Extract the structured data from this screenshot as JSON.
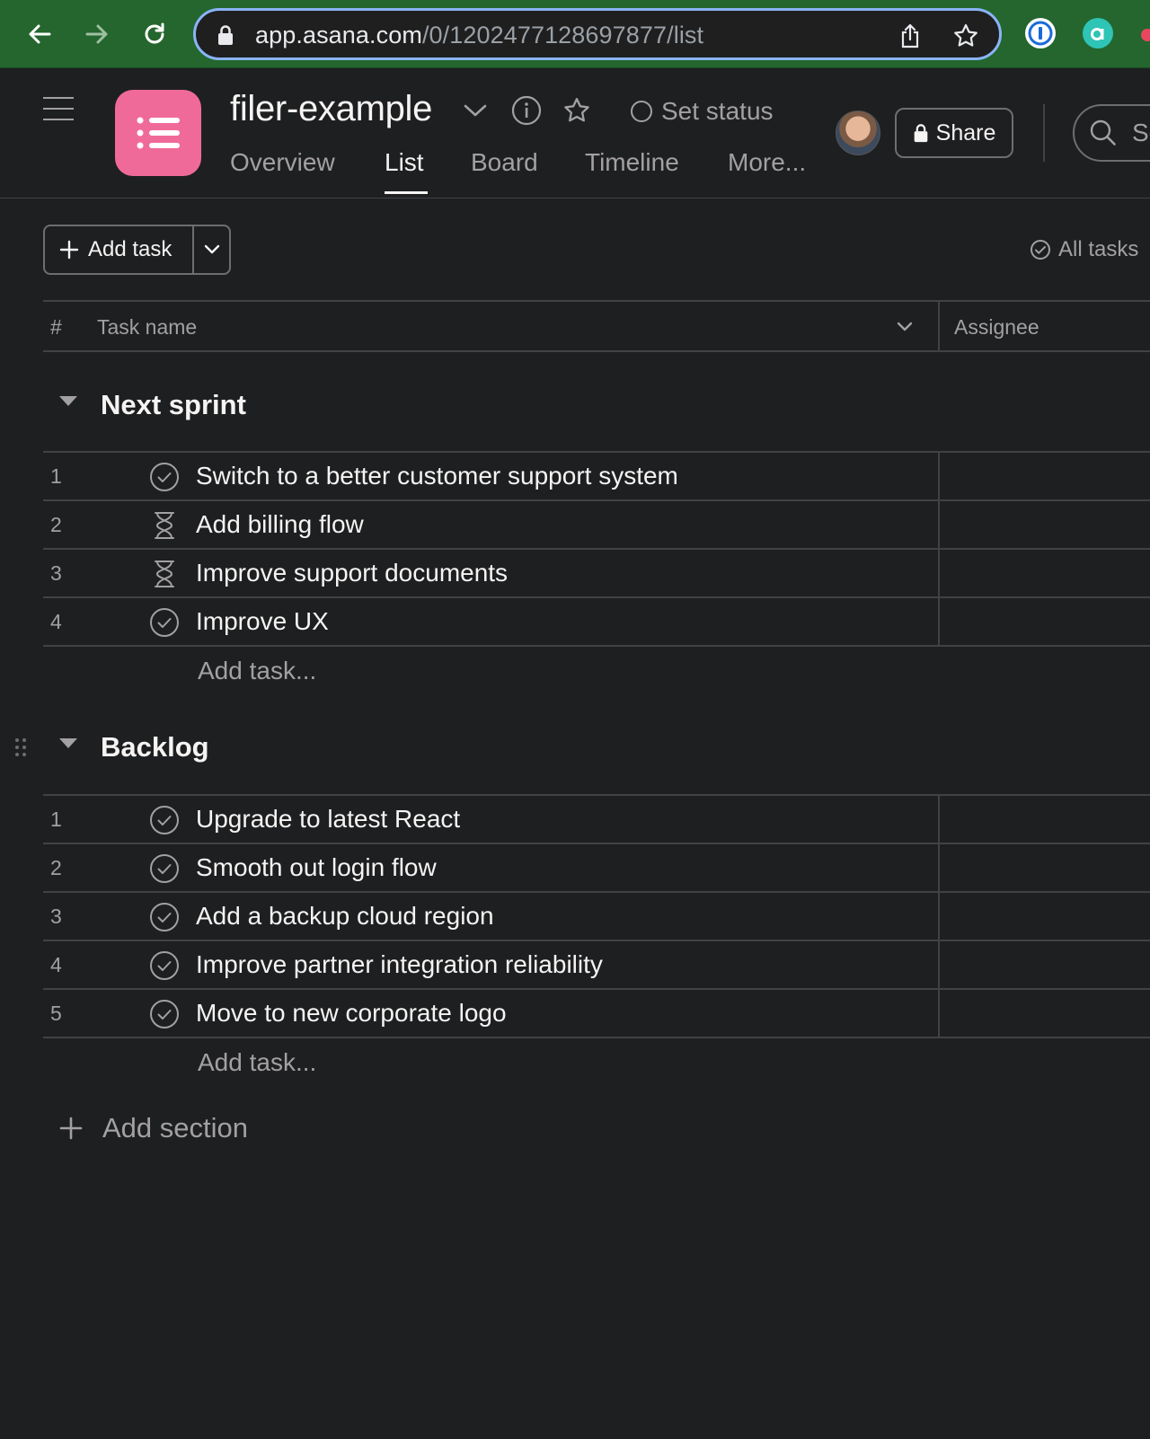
{
  "browser": {
    "url_host": "app.asana.com",
    "url_path": "/0/1202477128697877/list",
    "colors": {
      "toolbar": "#24662e",
      "omnibox_focus": "#8ab4f8"
    },
    "icons": [
      "back-arrow-icon",
      "forward-arrow-icon",
      "reload-icon",
      "lock-icon",
      "share-page-icon",
      "bookmark-star-icon",
      "password-manager-extension-icon",
      "asana-extension-icon"
    ]
  },
  "header": {
    "project_title": "filer-example",
    "set_status_label": "Set status",
    "tabs": [
      {
        "label": "Overview",
        "active": false
      },
      {
        "label": "List",
        "active": true
      },
      {
        "label": "Board",
        "active": false
      },
      {
        "label": "Timeline",
        "active": false
      },
      {
        "label": "More...",
        "active": false
      }
    ],
    "share_label": "Share",
    "search_placeholder": "Se",
    "project_color": "#f06a99"
  },
  "toolbar": {
    "add_task_label": "Add task",
    "filter_label": "All tasks"
  },
  "table": {
    "columns": {
      "number": "#",
      "task_name": "Task name",
      "assignee": "Assignee"
    },
    "add_task_inline": "Add task...",
    "sections": [
      {
        "name": "Next sprint",
        "tasks": [
          {
            "num": "1",
            "status": "check",
            "name": "Switch to a better customer support system"
          },
          {
            "num": "2",
            "status": "hourglass",
            "name": "Add billing flow"
          },
          {
            "num": "3",
            "status": "hourglass",
            "name": "Improve support documents"
          },
          {
            "num": "4",
            "status": "check",
            "name": "Improve UX"
          }
        ]
      },
      {
        "name": "Backlog",
        "tasks": [
          {
            "num": "1",
            "status": "check",
            "name": "Upgrade to latest React"
          },
          {
            "num": "2",
            "status": "check",
            "name": "Smooth out login flow"
          },
          {
            "num": "3",
            "status": "check",
            "name": "Add a backup cloud region"
          },
          {
            "num": "4",
            "status": "check",
            "name": "Improve partner integration reliability"
          },
          {
            "num": "5",
            "status": "check",
            "name": "Move to new corporate logo"
          }
        ]
      }
    ],
    "add_section_label": "Add section"
  }
}
